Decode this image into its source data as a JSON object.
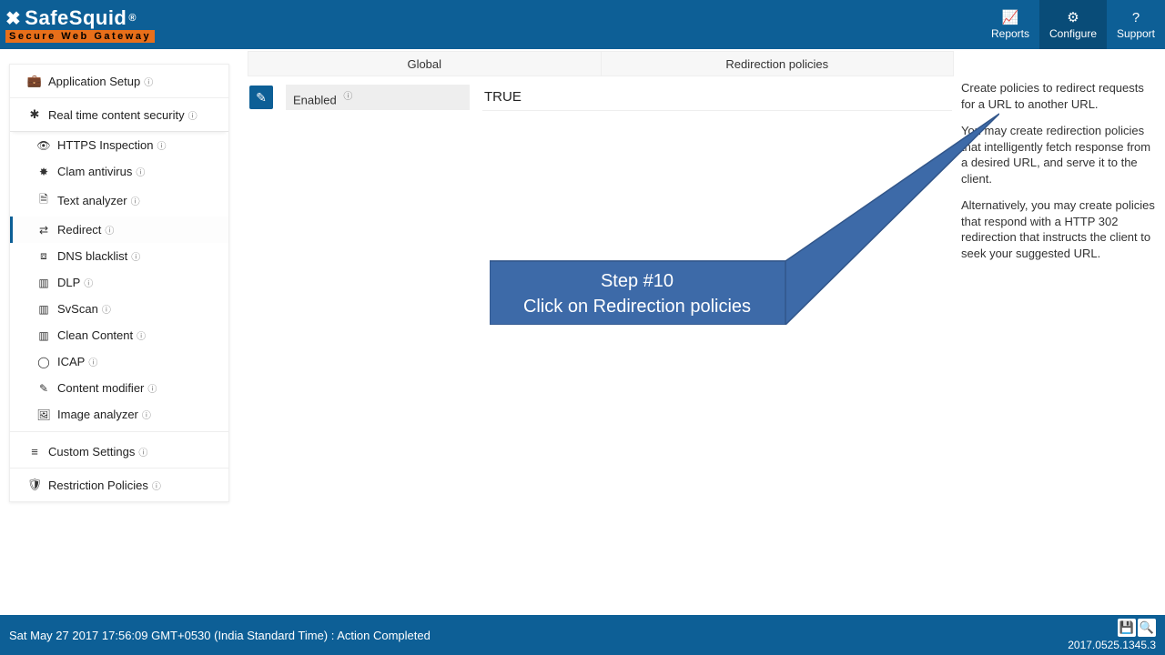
{
  "header": {
    "logo_main": "SafeSquid",
    "logo_reg": "®",
    "logo_sub": "Secure Web Gateway",
    "nav": [
      {
        "icon": "📈",
        "label": "Reports"
      },
      {
        "icon": "⚙",
        "label": "Configure"
      },
      {
        "icon": "?",
        "label": "Support"
      }
    ]
  },
  "sidebar": {
    "top_groups": [
      {
        "icon": "💼",
        "label": "Application Setup"
      },
      {
        "icon": "✱",
        "label": "Real time content security"
      }
    ],
    "sub_items": [
      {
        "icon": "👁",
        "label": "HTTPS Inspection"
      },
      {
        "icon": "✸",
        "label": "Clam antivirus"
      },
      {
        "icon": "🗎",
        "label": "Text analyzer"
      },
      {
        "icon": "⇄",
        "label": "Redirect",
        "active": true
      },
      {
        "icon": "⧈",
        "label": "DNS blacklist"
      },
      {
        "icon": "▥",
        "label": "DLP"
      },
      {
        "icon": "▥",
        "label": "SvScan"
      },
      {
        "icon": "▥",
        "label": "Clean Content"
      },
      {
        "icon": "◯",
        "label": "ICAP"
      },
      {
        "icon": "✎",
        "label": "Content modifier"
      },
      {
        "icon": "🖼",
        "label": "Image analyzer"
      }
    ],
    "bottom_groups": [
      {
        "icon": "≡",
        "label": "Custom Settings"
      },
      {
        "icon": "🛡",
        "label": "Restriction Policies"
      }
    ]
  },
  "tabs": [
    {
      "label": "Global"
    },
    {
      "label": "Redirection policies"
    }
  ],
  "config_row": {
    "label": "Enabled",
    "value": "TRUE"
  },
  "help": {
    "p1": "Create policies to redirect requests for a URL to another URL.",
    "p2": "You may create redirection policies that intelligently fetch response from a desired URL, and serve it to the client.",
    "p3": "Alternatively, you may create policies that respond with a HTTP 302 redirection that instructs the client to seek your suggested URL."
  },
  "callout": {
    "line1": "Step #10",
    "line2": "Click on Redirection policies"
  },
  "footer": {
    "status": "Sat May 27 2017 17:56:09 GMT+0530 (India Standard Time) : Action Completed",
    "version": "2017.0525.1345.3"
  }
}
